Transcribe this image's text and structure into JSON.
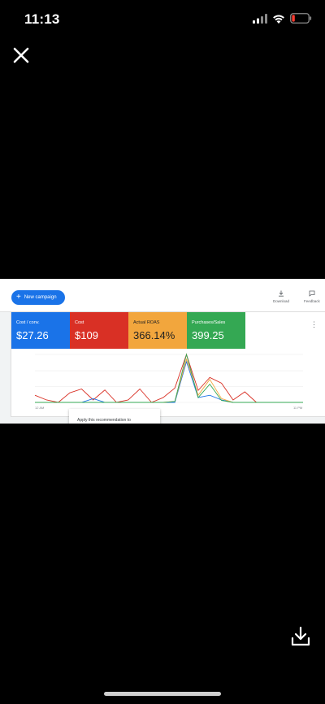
{
  "status_bar": {
    "time": "11:13"
  },
  "controls": {
    "close_icon": "close-icon",
    "download_icon": "download-icon"
  },
  "screenshot": {
    "new_campaign_label": "New campaign",
    "download_label": "Download",
    "feedback_label": "Feedback",
    "metrics": [
      {
        "label": "Cost / conv.",
        "value": "$27.26",
        "color": "#1a73e8"
      },
      {
        "label": "Cost",
        "value": "$109",
        "color": "#d93025"
      },
      {
        "label": "Actual ROAS",
        "value": "366.14%",
        "color": "#f2a63d"
      },
      {
        "label": "Purchases/Sales",
        "value": "399.25",
        "color": "#34a853"
      }
    ],
    "axis_start": "12 AM",
    "axis_end": "11 PM",
    "tooltip_text": "Apply this recommendation to"
  },
  "chart_data": {
    "type": "line",
    "x_start_label": "12 AM",
    "x_end_label": "11 PM",
    "x": [
      0,
      1,
      2,
      3,
      4,
      5,
      6,
      7,
      8,
      9,
      10,
      11,
      12,
      13,
      14,
      15,
      16,
      17,
      18,
      19,
      20,
      21,
      22,
      23
    ],
    "series": [
      {
        "color": "#d93025",
        "values": [
          0.15,
          0.05,
          0.0,
          0.2,
          0.28,
          0.05,
          0.26,
          0.0,
          0.05,
          0.28,
          0.0,
          0.1,
          0.3,
          1.0,
          0.25,
          0.52,
          0.4,
          0.05,
          0.22,
          0.0,
          0.0,
          0.0,
          0.0,
          0.0
        ]
      },
      {
        "color": "#1a73e8",
        "values": [
          0,
          0,
          0,
          0,
          0.0,
          0.08,
          0.0,
          0,
          0,
          0,
          0,
          0,
          0.0,
          0.85,
          0.1,
          0.15,
          0.05,
          0,
          0,
          0,
          0,
          0,
          0,
          0
        ]
      },
      {
        "color": "#f2a63d",
        "values": [
          0,
          0,
          0,
          0,
          0,
          0,
          0,
          0,
          0,
          0,
          0,
          0,
          0.02,
          0.9,
          0.15,
          0.48,
          0.08,
          0,
          0,
          0,
          0,
          0,
          0,
          0
        ]
      },
      {
        "color": "#34a853",
        "values": [
          0,
          0,
          0,
          0,
          0,
          0,
          0,
          0,
          0,
          0,
          0,
          0,
          0.02,
          1.0,
          0.1,
          0.38,
          0.04,
          0,
          0,
          0,
          0,
          0,
          0,
          0
        ]
      }
    ]
  }
}
